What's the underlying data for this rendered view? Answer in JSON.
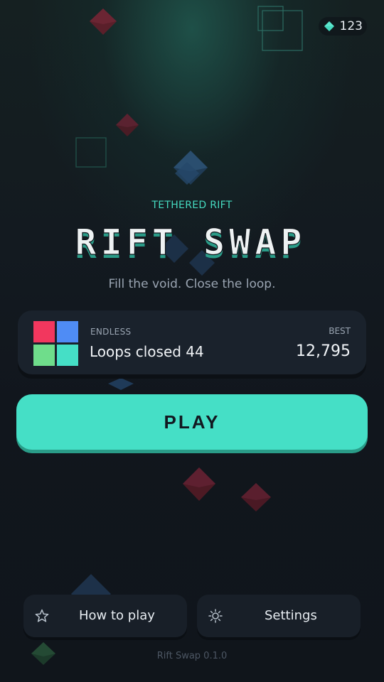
{
  "app": {
    "title": "RIFT SWAP",
    "subtitle": "TETHERED RIFT",
    "tagline": "Fill the void. Close the loop.",
    "version": "Rift Swap 0.1.0"
  },
  "currency": {
    "gems": "123",
    "icon": "gem-icon",
    "color": "#45d9bf"
  },
  "mode_card": {
    "mode": "ENDLESS",
    "loops": "Loops closed 44",
    "best_label": "BEST",
    "best_value": "12,795",
    "tile_colors": [
      "#f2375e",
      "#4f8cf5",
      "#6fdd8b",
      "#45dfc6"
    ]
  },
  "play": {
    "label": "PLAY",
    "color": "#45dfc6"
  },
  "bottom": {
    "how_to_play": {
      "label": "How to play",
      "icon": "star-icon"
    },
    "settings": {
      "label": "Settings",
      "icon": "sun-gear-icon"
    }
  },
  "colors": {
    "accent": "#45dfc6",
    "background": "#11161d",
    "card": "#1a222c"
  }
}
